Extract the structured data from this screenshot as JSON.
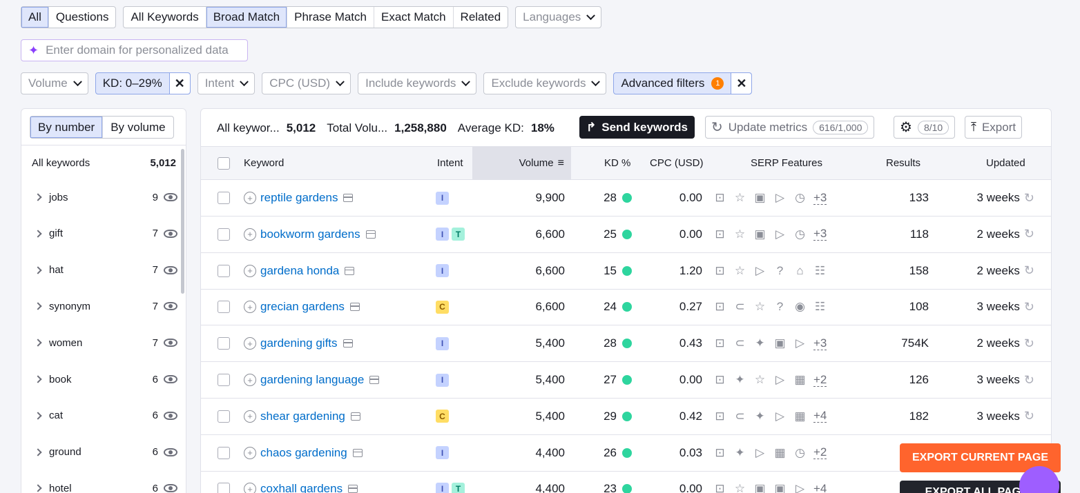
{
  "tabs_type": [
    "All",
    "Questions"
  ],
  "tabs_match": [
    "All Keywords",
    "Broad Match",
    "Phrase Match",
    "Exact Match",
    "Related"
  ],
  "languages_label": "Languages",
  "domain_placeholder": "Enter domain for personalized data",
  "filters": {
    "volume": "Volume",
    "kd_chip": "KD: 0–29%",
    "intent": "Intent",
    "cpc": "CPC (USD)",
    "include": "Include keywords",
    "exclude": "Exclude keywords",
    "advanced": "Advanced filters",
    "advanced_count": "1"
  },
  "sidebar": {
    "by_number": "By number",
    "by_volume": "By volume",
    "all_label": "All keywords",
    "all_count": "5,012",
    "items": [
      {
        "name": "jobs",
        "count": "9"
      },
      {
        "name": "gift",
        "count": "7"
      },
      {
        "name": "hat",
        "count": "7"
      },
      {
        "name": "synonym",
        "count": "7"
      },
      {
        "name": "women",
        "count": "7"
      },
      {
        "name": "book",
        "count": "6"
      },
      {
        "name": "cat",
        "count": "6"
      },
      {
        "name": "ground",
        "count": "6"
      },
      {
        "name": "hotel",
        "count": "6"
      }
    ]
  },
  "stats": {
    "all_label": "All keywor...",
    "all_value": "5,012",
    "total_label": "Total Volu...",
    "total_value": "1,258,880",
    "avg_label": "Average KD:",
    "avg_value": "18%"
  },
  "toolbar": {
    "send": "Send keywords",
    "update": "Update metrics",
    "update_count": "616/1,000",
    "settings_count": "8/10",
    "export": "Export"
  },
  "columns": {
    "keyword": "Keyword",
    "intent": "Intent",
    "volume": "Volume",
    "kd": "KD %",
    "cpc": "CPC (USD)",
    "serp": "SERP Features",
    "results": "Results",
    "updated": "Updated"
  },
  "rows": [
    {
      "keyword": "reptile gardens",
      "intents": [
        "I"
      ],
      "volume": "9,900",
      "kd": "28",
      "cpc": "0.00",
      "serp": [
        "☆",
        "▣",
        "▷",
        "◷"
      ],
      "more": "+3",
      "results": "133",
      "updated": "3 weeks"
    },
    {
      "keyword": "bookworm gardens",
      "intents": [
        "I",
        "T"
      ],
      "volume": "6,600",
      "kd": "25",
      "cpc": "0.00",
      "serp": [
        "☆",
        "▣",
        "▷",
        "◷"
      ],
      "more": "+3",
      "results": "118",
      "updated": "2 weeks"
    },
    {
      "keyword": "gardena honda",
      "intents": [
        "I"
      ],
      "volume": "6,600",
      "kd": "15",
      "cpc": "1.20",
      "serp": [
        "☆",
        "▷",
        "?",
        "⌂",
        "☷"
      ],
      "more": "",
      "results": "158",
      "updated": "2 weeks"
    },
    {
      "keyword": "grecian gardens",
      "intents": [
        "C"
      ],
      "volume": "6,600",
      "kd": "24",
      "cpc": "0.27",
      "serp": [
        "⊂",
        "☆",
        "?",
        "◉",
        "☷"
      ],
      "more": "",
      "results": "108",
      "updated": "3 weeks"
    },
    {
      "keyword": "gardening gifts",
      "intents": [
        "I"
      ],
      "volume": "5,400",
      "kd": "28",
      "cpc": "0.43",
      "serp": [
        "⊂",
        "✦",
        "▣",
        "▷"
      ],
      "more": "+3",
      "results": "754K",
      "updated": "2 weeks"
    },
    {
      "keyword": "gardening language",
      "intents": [
        "I"
      ],
      "volume": "5,400",
      "kd": "27",
      "cpc": "0.00",
      "serp": [
        "✦",
        "☆",
        "▷",
        "▦"
      ],
      "more": "+2",
      "results": "126",
      "updated": "3 weeks"
    },
    {
      "keyword": "shear gardening",
      "intents": [
        "C"
      ],
      "volume": "5,400",
      "kd": "29",
      "cpc": "0.42",
      "serp": [
        "⊂",
        "✦",
        "▷",
        "▦"
      ],
      "more": "+4",
      "results": "182",
      "updated": "3 weeks"
    },
    {
      "keyword": "chaos gardening",
      "intents": [
        "I"
      ],
      "volume": "4,400",
      "kd": "26",
      "cpc": "0.03",
      "serp": [
        "✦",
        "▷",
        "▦",
        "◷"
      ],
      "more": "+2",
      "results": "",
      "updated": ""
    },
    {
      "keyword": "coxhall gardens",
      "intents": [
        "I",
        "T"
      ],
      "volume": "4,400",
      "kd": "23",
      "cpc": "0.00",
      "serp": [
        "☆",
        "▣",
        "▣",
        "▷"
      ],
      "more": "+4",
      "results": "",
      "updated": ""
    }
  ],
  "export_current": "EXPORT CURRENT PAGE",
  "export_all": "EXPORT ALL PAGES"
}
